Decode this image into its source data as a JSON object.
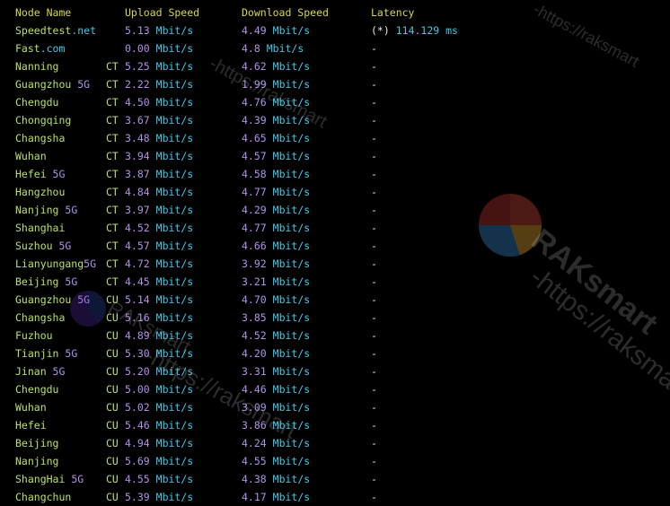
{
  "colors": {
    "background": "#000000",
    "header": "#d7d73f",
    "node_name": "#b8e063",
    "node_suffix": "#b48fe8",
    "isp": "#b8e063",
    "upload": "#b48fe8",
    "download": "#b48fe8",
    "unit": "#41c8e6",
    "latency_value": "#41c8e6"
  },
  "header": {
    "node_name": "Node Name",
    "upload_speed": "Upload Speed",
    "download_speed": "Download Speed",
    "latency": "Latency"
  },
  "rows": [
    {
      "name": "Speedtest",
      "suffix": ".net",
      "isp": "",
      "upload": "5.13",
      "upload_unit": "Mbit/s",
      "download": "4.49",
      "download_unit": "Mbit/s",
      "latency_prefix": "(*)",
      "latency": "114.129 ms"
    },
    {
      "name": "Fast",
      "suffix": ".com",
      "isp": "",
      "upload": "0.00",
      "upload_unit": "Mbit/s",
      "download": "4.8",
      "download_unit": "Mbit/s",
      "latency_prefix": "",
      "latency": "-"
    },
    {
      "name": "Nanning",
      "suffix": "",
      "isp": "CT",
      "upload": "5.25",
      "upload_unit": "Mbit/s",
      "download": "4.62",
      "download_unit": "Mbit/s",
      "latency_prefix": "",
      "latency": "-"
    },
    {
      "name": "Guangzhou",
      "suffix": " 5G",
      "isp": "CT",
      "upload": "2.22",
      "upload_unit": "Mbit/s",
      "download": "1.99",
      "download_unit": "Mbit/s",
      "latency_prefix": "",
      "latency": "-"
    },
    {
      "name": "Chengdu",
      "suffix": "",
      "isp": "CT",
      "upload": "4.50",
      "upload_unit": "Mbit/s",
      "download": "4.76",
      "download_unit": "Mbit/s",
      "latency_prefix": "",
      "latency": "-"
    },
    {
      "name": "Chongqing",
      "suffix": "",
      "isp": "CT",
      "upload": "3.67",
      "upload_unit": "Mbit/s",
      "download": "4.39",
      "download_unit": "Mbit/s",
      "latency_prefix": "",
      "latency": "-"
    },
    {
      "name": "Changsha",
      "suffix": "",
      "isp": "CT",
      "upload": "3.48",
      "upload_unit": "Mbit/s",
      "download": "4.65",
      "download_unit": "Mbit/s",
      "latency_prefix": "",
      "latency": "-"
    },
    {
      "name": "Wuhan",
      "suffix": "",
      "isp": "CT",
      "upload": "3.94",
      "upload_unit": "Mbit/s",
      "download": "4.57",
      "download_unit": "Mbit/s",
      "latency_prefix": "",
      "latency": "-"
    },
    {
      "name": "Hefei",
      "suffix": " 5G",
      "isp": "CT",
      "upload": "3.87",
      "upload_unit": "Mbit/s",
      "download": "4.58",
      "download_unit": "Mbit/s",
      "latency_prefix": "",
      "latency": "-"
    },
    {
      "name": "Hangzhou",
      "suffix": "",
      "isp": "CT",
      "upload": "4.84",
      "upload_unit": "Mbit/s",
      "download": "4.77",
      "download_unit": "Mbit/s",
      "latency_prefix": "",
      "latency": "-"
    },
    {
      "name": "Nanjing",
      "suffix": " 5G",
      "isp": "CT",
      "upload": "3.97",
      "upload_unit": "Mbit/s",
      "download": "4.29",
      "download_unit": "Mbit/s",
      "latency_prefix": "",
      "latency": "-"
    },
    {
      "name": "Shanghai",
      "suffix": "",
      "isp": "CT",
      "upload": "4.52",
      "upload_unit": "Mbit/s",
      "download": "4.77",
      "download_unit": "Mbit/s",
      "latency_prefix": "",
      "latency": "-"
    },
    {
      "name": "Suzhou",
      "suffix": " 5G",
      "isp": "CT",
      "upload": "4.57",
      "upload_unit": "Mbit/s",
      "download": "4.66",
      "download_unit": "Mbit/s",
      "latency_prefix": "",
      "latency": "-"
    },
    {
      "name": "Lianyungang",
      "suffix": "5G",
      "isp": "CT",
      "upload": "4.72",
      "upload_unit": "Mbit/s",
      "download": "3.92",
      "download_unit": "Mbit/s",
      "latency_prefix": "",
      "latency": "-"
    },
    {
      "name": "Beijing",
      "suffix": " 5G",
      "isp": "CT",
      "upload": "4.45",
      "upload_unit": "Mbit/s",
      "download": "3.21",
      "download_unit": "Mbit/s",
      "latency_prefix": "",
      "latency": "-"
    },
    {
      "name": "Guangzhou",
      "suffix": " 5G",
      "isp": "CU",
      "upload": "5.14",
      "upload_unit": "Mbit/s",
      "download": "4.70",
      "download_unit": "Mbit/s",
      "latency_prefix": "",
      "latency": "-"
    },
    {
      "name": "Changsha",
      "suffix": "",
      "isp": "CU",
      "upload": "5.16",
      "upload_unit": "Mbit/s",
      "download": "3.85",
      "download_unit": "Mbit/s",
      "latency_prefix": "",
      "latency": "-"
    },
    {
      "name": "Fuzhou",
      "suffix": "",
      "isp": "CU",
      "upload": "4.89",
      "upload_unit": "Mbit/s",
      "download": "4.52",
      "download_unit": "Mbit/s",
      "latency_prefix": "",
      "latency": "-"
    },
    {
      "name": "Tianjin",
      "suffix": " 5G",
      "isp": "CU",
      "upload": "5.30",
      "upload_unit": "Mbit/s",
      "download": "4.20",
      "download_unit": "Mbit/s",
      "latency_prefix": "",
      "latency": "-"
    },
    {
      "name": "Jinan",
      "suffix": " 5G",
      "isp": "CU",
      "upload": "5.20",
      "upload_unit": "Mbit/s",
      "download": "3.31",
      "download_unit": "Mbit/s",
      "latency_prefix": "",
      "latency": "-"
    },
    {
      "name": "Chengdu",
      "suffix": "",
      "isp": "CU",
      "upload": "5.00",
      "upload_unit": "Mbit/s",
      "download": "4.46",
      "download_unit": "Mbit/s",
      "latency_prefix": "",
      "latency": "-"
    },
    {
      "name": "Wuhan",
      "suffix": "",
      "isp": "CU",
      "upload": "5.02",
      "upload_unit": "Mbit/s",
      "download": "3.09",
      "download_unit": "Mbit/s",
      "latency_prefix": "",
      "latency": "-"
    },
    {
      "name": "Hefei",
      "suffix": "",
      "isp": "CU",
      "upload": "5.46",
      "upload_unit": "Mbit/s",
      "download": "3.86",
      "download_unit": "Mbit/s",
      "latency_prefix": "",
      "latency": "-"
    },
    {
      "name": "Beijing",
      "suffix": "",
      "isp": "CU",
      "upload": "4.94",
      "upload_unit": "Mbit/s",
      "download": "4.24",
      "download_unit": "Mbit/s",
      "latency_prefix": "",
      "latency": "-"
    },
    {
      "name": "Nanjing",
      "suffix": "",
      "isp": "CU",
      "upload": "5.69",
      "upload_unit": "Mbit/s",
      "download": "4.55",
      "download_unit": "Mbit/s",
      "latency_prefix": "",
      "latency": "-"
    },
    {
      "name": "ShangHai",
      "suffix": " 5G",
      "isp": "CU",
      "upload": "4.55",
      "upload_unit": "Mbit/s",
      "download": "4.38",
      "download_unit": "Mbit/s",
      "latency_prefix": "",
      "latency": "-"
    },
    {
      "name": "Changchun",
      "suffix": "",
      "isp": "CU",
      "upload": "5.39",
      "upload_unit": "Mbit/s",
      "download": "4.17",
      "download_unit": "Mbit/s",
      "latency_prefix": "",
      "latency": "-"
    }
  ],
  "watermark": {
    "brand": "RAKsmart",
    "url": "-https://raksmart"
  }
}
